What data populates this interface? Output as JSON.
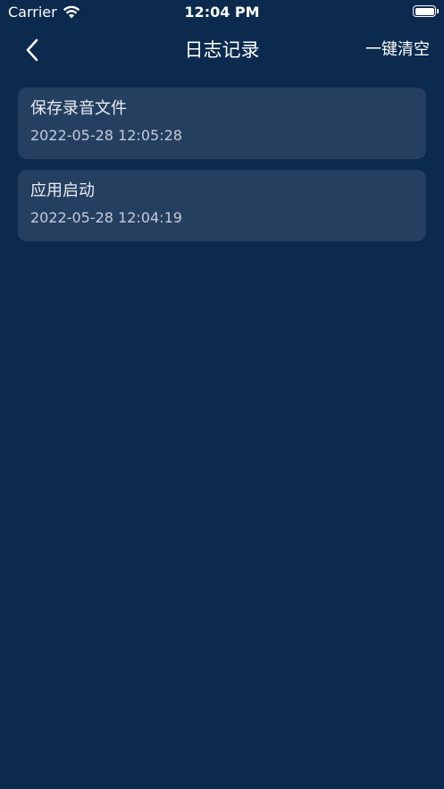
{
  "status_bar": {
    "carrier": "Carrier",
    "time": "12:04 PM",
    "battery_level": 1.0
  },
  "nav": {
    "title": "日志记录",
    "clear_label": "一键清空"
  },
  "logs": [
    {
      "title": "保存录音文件",
      "time": "2022-05-28 12:05:28"
    },
    {
      "title": "应用启动",
      "time": "2022-05-28 12:04:19"
    }
  ],
  "colors": {
    "background": "#0b2a4e",
    "card": "#253f60",
    "text": "#ffffff"
  }
}
